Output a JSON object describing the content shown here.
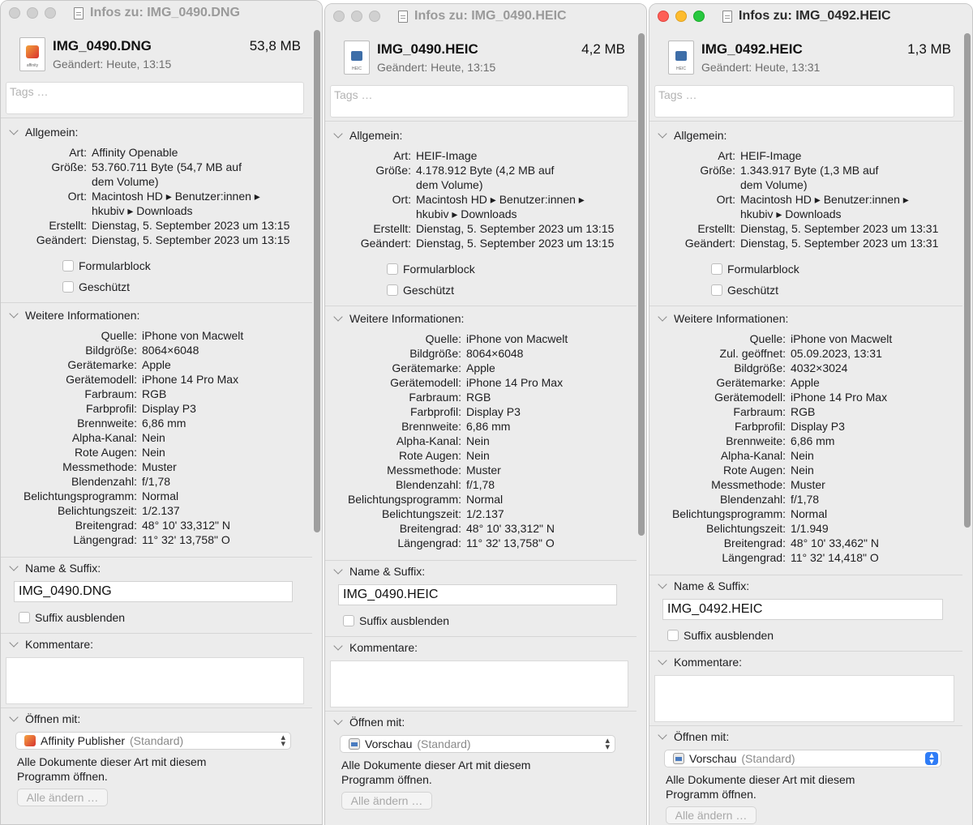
{
  "windows": [
    {
      "id": "w1",
      "active": false,
      "title": "Infos zu: IMG_0490.DNG",
      "file_name": "IMG_0490.DNG",
      "file_size": "53,8 MB",
      "modified": "Geändert: Heute, 13:15",
      "icon_tag": "affinity",
      "tags_placeholder": "Tags …",
      "general_heading": "Allgemein:",
      "general": [
        {
          "k": "Art:",
          "v": [
            "Affinity Openable"
          ]
        },
        {
          "k": "Größe:",
          "v": [
            "53.760.711 Byte (54,7 MB auf",
            "dem Volume)"
          ]
        },
        {
          "k": "Ort:",
          "v": [
            "Macintosh HD ▸ Benutzer:innen ▸",
            "hkubiv ▸ Downloads"
          ]
        },
        {
          "k": "Erstellt:",
          "v": [
            "Dienstag, 5. September 2023 um 13:15"
          ]
        },
        {
          "k": "Geändert:",
          "v": [
            "Dienstag, 5. September 2023 um 13:15"
          ]
        }
      ],
      "checkbox_formular": "Formularblock",
      "checkbox_geschuetzt": "Geschützt",
      "more_heading": "Weitere Informationen:",
      "more": [
        {
          "k": "Quelle:",
          "v": "iPhone von Macwelt"
        },
        {
          "k": "Bildgröße:",
          "v": "8064×6048"
        },
        {
          "k": "Gerätemarke:",
          "v": "Apple"
        },
        {
          "k": "Gerätemodell:",
          "v": "iPhone 14 Pro Max"
        },
        {
          "k": "Farbraum:",
          "v": "RGB"
        },
        {
          "k": "Farbprofil:",
          "v": "Display P3"
        },
        {
          "k": "Brennweite:",
          "v": "6,86 mm"
        },
        {
          "k": "Alpha-Kanal:",
          "v": "Nein"
        },
        {
          "k": "Rote Augen:",
          "v": "Nein"
        },
        {
          "k": "Messmethode:",
          "v": "Muster"
        },
        {
          "k": "Blendenzahl:",
          "v": "f/1,78"
        },
        {
          "k": "Belichtungsprogramm:",
          "v": "Normal"
        },
        {
          "k": "Belichtungszeit:",
          "v": "1/2.137"
        },
        {
          "k": "Breitengrad:",
          "v": "48° 10' 33,312\" N"
        },
        {
          "k": "Längengrad:",
          "v": "11° 32' 13,758\" O"
        }
      ],
      "name_heading": "Name & Suffix:",
      "name_value": "IMG_0490.DNG",
      "hide_suffix": "Suffix ausblenden",
      "comments_heading": "Kommentare:",
      "open_heading": "Öffnen mit:",
      "open_app": "Affinity Publisher",
      "open_default": "(Standard)",
      "open_app_icon": "affinity-publisher-icon",
      "open_note": "Alle Dokumente dieser Art mit diesem Programm öffnen.",
      "change_all": "Alle ändern …"
    },
    {
      "id": "w2",
      "active": false,
      "title": "Infos zu: IMG_0490.HEIC",
      "file_name": "IMG_0490.HEIC",
      "file_size": "4,2 MB",
      "modified": "Geändert: Heute, 13:15",
      "icon_tag": "HEIC",
      "tags_placeholder": "Tags …",
      "general_heading": "Allgemein:",
      "general": [
        {
          "k": "Art:",
          "v": [
            "HEIF-Image"
          ]
        },
        {
          "k": "Größe:",
          "v": [
            "4.178.912 Byte (4,2 MB auf",
            "dem Volume)"
          ]
        },
        {
          "k": "Ort:",
          "v": [
            "Macintosh HD ▸ Benutzer:innen ▸",
            "hkubiv ▸ Downloads"
          ]
        },
        {
          "k": "Erstellt:",
          "v": [
            "Dienstag, 5. September 2023 um 13:15"
          ]
        },
        {
          "k": "Geändert:",
          "v": [
            "Dienstag, 5. September 2023 um 13:15"
          ]
        }
      ],
      "checkbox_formular": "Formularblock",
      "checkbox_geschuetzt": "Geschützt",
      "more_heading": "Weitere Informationen:",
      "more": [
        {
          "k": "Quelle:",
          "v": "iPhone von Macwelt"
        },
        {
          "k": "Bildgröße:",
          "v": "8064×6048"
        },
        {
          "k": "Gerätemarke:",
          "v": "Apple"
        },
        {
          "k": "Gerätemodell:",
          "v": "iPhone 14 Pro Max"
        },
        {
          "k": "Farbraum:",
          "v": "RGB"
        },
        {
          "k": "Farbprofil:",
          "v": "Display P3"
        },
        {
          "k": "Brennweite:",
          "v": "6,86 mm"
        },
        {
          "k": "Alpha-Kanal:",
          "v": "Nein"
        },
        {
          "k": "Rote Augen:",
          "v": "Nein"
        },
        {
          "k": "Messmethode:",
          "v": "Muster"
        },
        {
          "k": "Blendenzahl:",
          "v": "f/1,78"
        },
        {
          "k": "Belichtungsprogramm:",
          "v": "Normal"
        },
        {
          "k": "Belichtungszeit:",
          "v": "1/2.137"
        },
        {
          "k": "Breitengrad:",
          "v": "48° 10' 33,312\" N"
        },
        {
          "k": "Längengrad:",
          "v": "11° 32' 13,758\" O"
        }
      ],
      "name_heading": "Name & Suffix:",
      "name_value": "IMG_0490.HEIC",
      "hide_suffix": "Suffix ausblenden",
      "comments_heading": "Kommentare:",
      "open_heading": "Öffnen mit:",
      "open_app": "Vorschau",
      "open_default": "(Standard)",
      "open_app_icon": "preview-icon",
      "open_note": "Alle Dokumente dieser Art mit diesem Programm öffnen.",
      "change_all": "Alle ändern …"
    },
    {
      "id": "w3",
      "active": true,
      "title": "Infos zu: IMG_0492.HEIC",
      "file_name": "IMG_0492.HEIC",
      "file_size": "1,3 MB",
      "modified": "Geändert: Heute, 13:31",
      "icon_tag": "HEIC",
      "tags_placeholder": "Tags …",
      "general_heading": "Allgemein:",
      "general": [
        {
          "k": "Art:",
          "v": [
            "HEIF-Image"
          ]
        },
        {
          "k": "Größe:",
          "v": [
            "1.343.917 Byte (1,3 MB auf",
            "dem Volume)"
          ]
        },
        {
          "k": "Ort:",
          "v": [
            "Macintosh HD ▸ Benutzer:innen ▸",
            "hkubiv ▸ Downloads"
          ]
        },
        {
          "k": "Erstellt:",
          "v": [
            "Dienstag, 5. September 2023 um 13:31"
          ]
        },
        {
          "k": "Geändert:",
          "v": [
            "Dienstag, 5. September 2023 um 13:31"
          ]
        }
      ],
      "checkbox_formular": "Formularblock",
      "checkbox_geschuetzt": "Geschützt",
      "more_heading": "Weitere Informationen:",
      "more": [
        {
          "k": "Quelle:",
          "v": "iPhone von Macwelt"
        },
        {
          "k": "Zul. geöffnet:",
          "v": "05.09.2023, 13:31"
        },
        {
          "k": "Bildgröße:",
          "v": "4032×3024"
        },
        {
          "k": "Gerätemarke:",
          "v": "Apple"
        },
        {
          "k": "Gerätemodell:",
          "v": "iPhone 14 Pro Max"
        },
        {
          "k": "Farbraum:",
          "v": "RGB"
        },
        {
          "k": "Farbprofil:",
          "v": "Display P3"
        },
        {
          "k": "Brennweite:",
          "v": "6,86 mm"
        },
        {
          "k": "Alpha-Kanal:",
          "v": "Nein"
        },
        {
          "k": "Rote Augen:",
          "v": "Nein"
        },
        {
          "k": "Messmethode:",
          "v": "Muster"
        },
        {
          "k": "Blendenzahl:",
          "v": "f/1,78"
        },
        {
          "k": "Belichtungsprogramm:",
          "v": "Normal"
        },
        {
          "k": "Belichtungszeit:",
          "v": "1/1.949"
        },
        {
          "k": "Breitengrad:",
          "v": "48° 10' 33,462\" N"
        },
        {
          "k": "Längengrad:",
          "v": "11° 32' 14,418\" O"
        }
      ],
      "name_heading": "Name & Suffix:",
      "name_value": "IMG_0492.HEIC",
      "hide_suffix": "Suffix ausblenden",
      "comments_heading": "Kommentare:",
      "open_heading": "Öffnen mit:",
      "open_app": "Vorschau",
      "open_default": "(Standard)",
      "open_app_icon": "preview-icon",
      "open_note": "Alle Dokumente dieser Art mit diesem Programm öffnen.",
      "change_all": "Alle ändern …"
    }
  ],
  "colors": {
    "close": "#fe5f57",
    "minimize": "#febc2e",
    "zoom": "#28c840",
    "popup_accent": "#2f7cf6"
  }
}
